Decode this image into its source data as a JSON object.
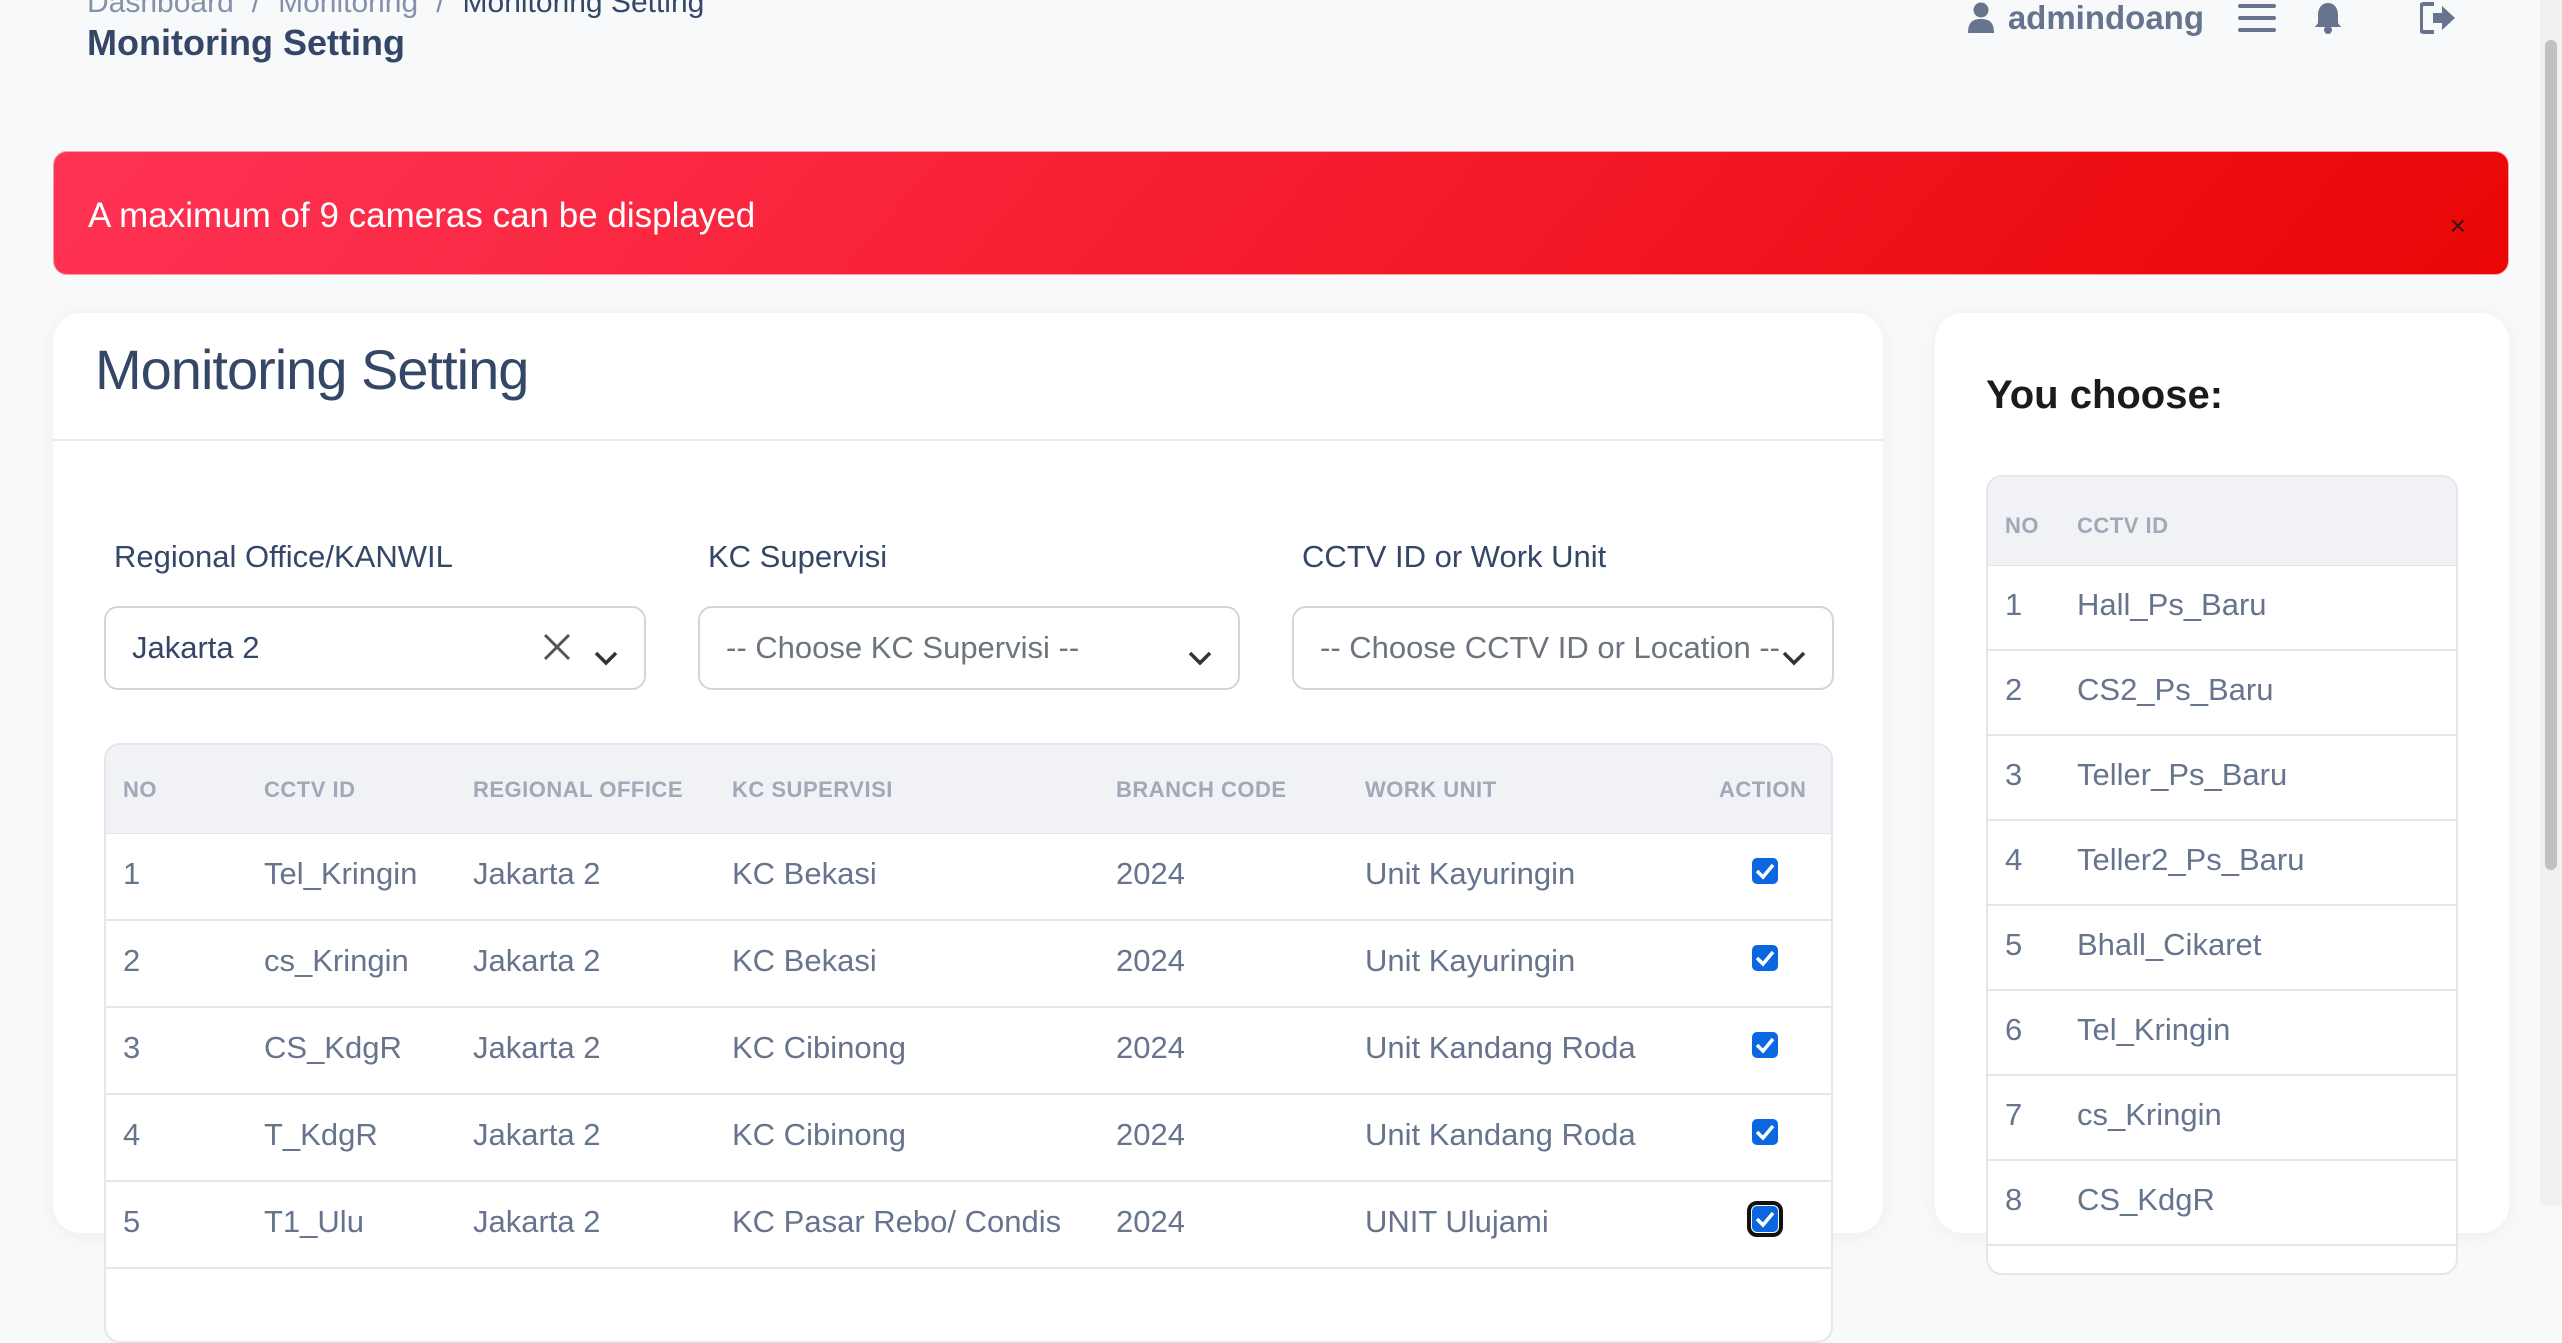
{
  "breadcrumb": {
    "items": [
      "Dashboard",
      "Monitoring",
      "Monitoring Setting"
    ],
    "separator": "/"
  },
  "page_title": "Monitoring Setting",
  "topnav": {
    "username": "admindoang"
  },
  "alert": {
    "message": "A maximum of 9 cameras can be displayed",
    "close": "×",
    "color": "#ea0606"
  },
  "card": {
    "title": "Monitoring Setting"
  },
  "filters": {
    "regional": {
      "label": "Regional Office/KANWIL",
      "value": "Jakarta 2"
    },
    "kc": {
      "label": "KC Supervisi",
      "placeholder": "-- Choose KC Supervisi --"
    },
    "cctv": {
      "label": "CCTV ID or Work Unit",
      "placeholder": "-- Choose CCTV ID or Location --"
    }
  },
  "table": {
    "headers": {
      "no": "NO",
      "cctv": "CCTV ID",
      "regional": "REGIONAL OFFICE",
      "kc": "KC SUPERVISI",
      "branch": "BRANCH CODE",
      "unit": "WORK UNIT",
      "action": "ACTION"
    },
    "rows": [
      {
        "no": "1",
        "cctv": "Tel_Kringin",
        "regional": "Jakarta 2",
        "kc": "KC Bekasi",
        "branch": "2024",
        "unit": "Unit Kayuringin",
        "checked": true
      },
      {
        "no": "2",
        "cctv": "cs_Kringin",
        "regional": "Jakarta 2",
        "kc": "KC Bekasi",
        "branch": "2024",
        "unit": "Unit Kayuringin",
        "checked": true
      },
      {
        "no": "3",
        "cctv": "CS_KdgR",
        "regional": "Jakarta 2",
        "kc": "KC Cibinong",
        "branch": "2024",
        "unit": "Unit Kandang Roda",
        "checked": true
      },
      {
        "no": "4",
        "cctv": "T_KdgR",
        "regional": "Jakarta 2",
        "kc": "KC Cibinong",
        "branch": "2024",
        "unit": "Unit Kandang Roda",
        "checked": true
      },
      {
        "no": "5",
        "cctv": "T1_Ulu",
        "regional": "Jakarta 2",
        "kc": "KC Pasar Rebo/ Condis",
        "branch": "2024",
        "unit": "UNIT Ulujami",
        "checked": true
      }
    ]
  },
  "side": {
    "title": "You choose:",
    "headers": {
      "no": "NO",
      "cctv": "CCTV ID"
    },
    "rows": [
      {
        "no": "1",
        "cctv": "Hall_Ps_Baru"
      },
      {
        "no": "2",
        "cctv": "CS2_Ps_Baru"
      },
      {
        "no": "3",
        "cctv": "Teller_Ps_Baru"
      },
      {
        "no": "4",
        "cctv": "Teller2_Ps_Baru"
      },
      {
        "no": "5",
        "cctv": "Bhall_Cikaret"
      },
      {
        "no": "6",
        "cctv": "Tel_Kringin"
      },
      {
        "no": "7",
        "cctv": "cs_Kringin"
      },
      {
        "no": "8",
        "cctv": "CS_KdgR"
      }
    ]
  }
}
